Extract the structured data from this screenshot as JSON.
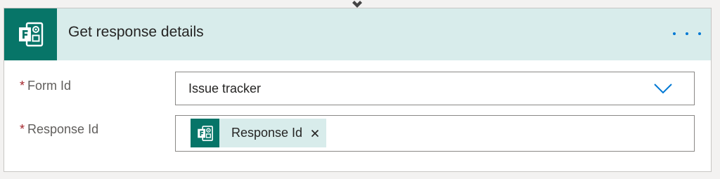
{
  "action": {
    "title": "Get response details",
    "icon": "forms-icon",
    "more_icon": "more-options-icon"
  },
  "fields": {
    "form_id": {
      "required_marker": "*",
      "label": "Form Id",
      "value": "Issue tracker",
      "icon": "chevron-down-icon"
    },
    "response_id": {
      "required_marker": "*",
      "label": "Response Id",
      "token": {
        "label": "Response Id",
        "icon": "forms-icon",
        "remove_icon": "close-icon"
      }
    }
  },
  "colors": {
    "brand": "#077568",
    "header_bg": "#d8eceb",
    "accent": "#0078d4",
    "required": "#a4262c"
  }
}
